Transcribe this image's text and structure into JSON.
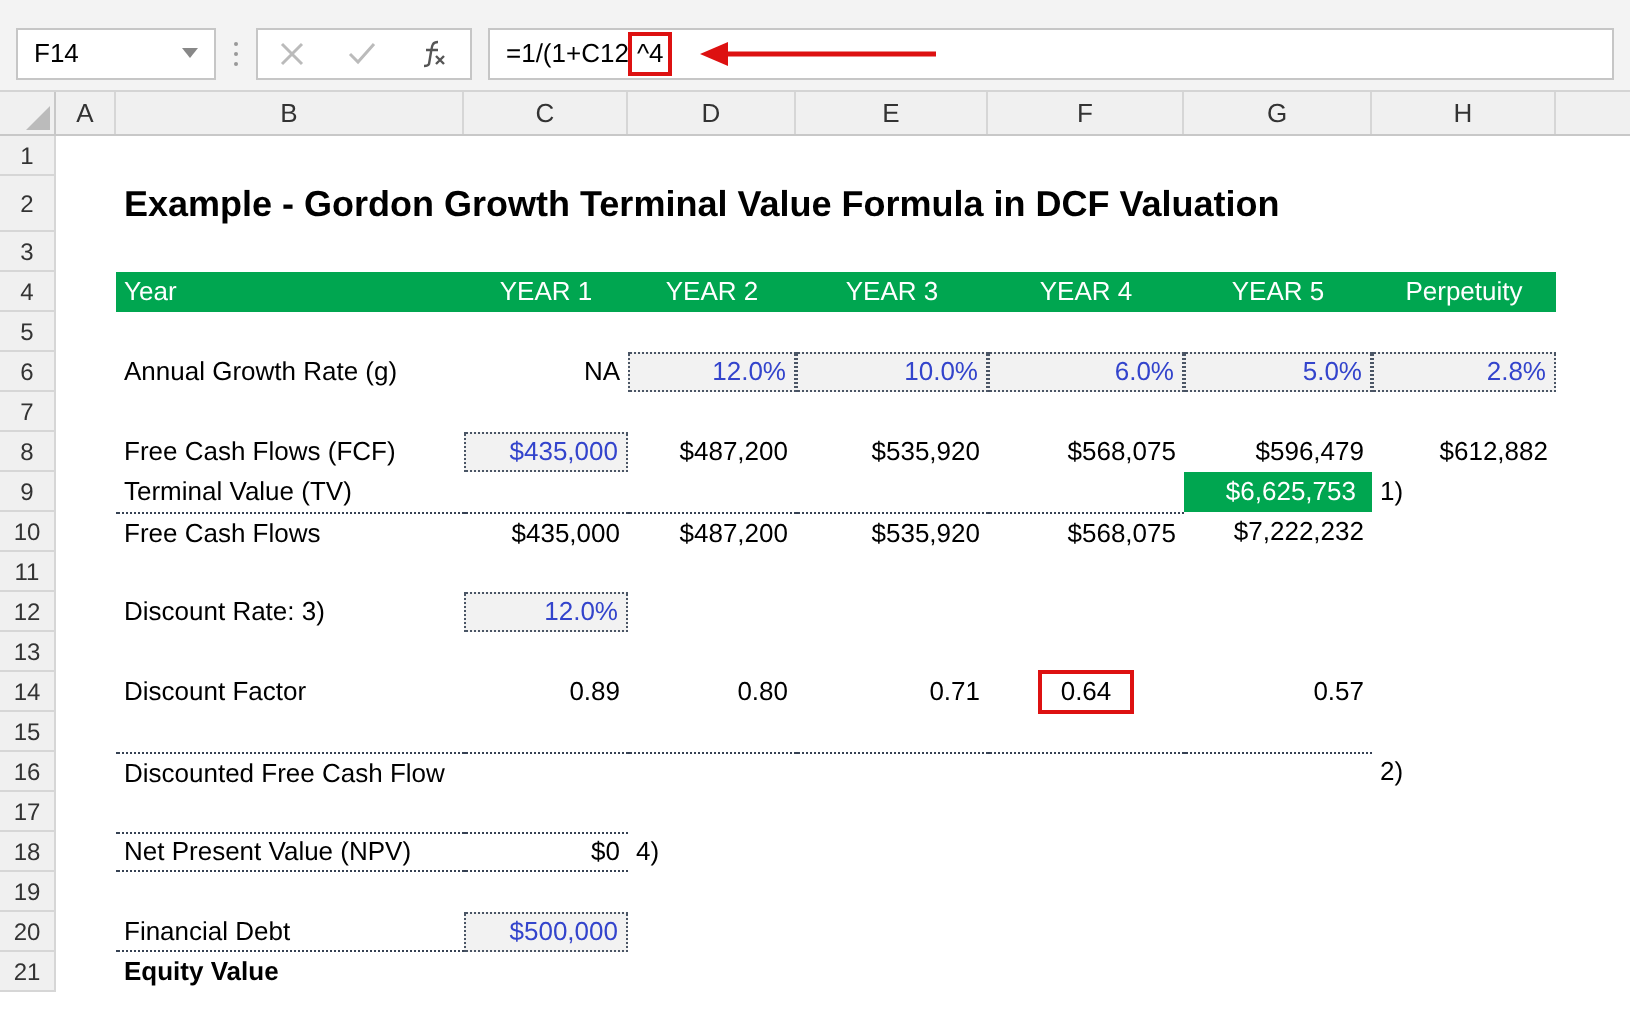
{
  "formula_bar": {
    "name_box": "F14",
    "formula": "=1/(1+C12",
    "formula_highlight": "^4"
  },
  "columns": [
    "A",
    "B",
    "C",
    "D",
    "E",
    "F",
    "G",
    "H"
  ],
  "rows": [
    {
      "number": "1",
      "cells": {}
    },
    {
      "number": "2",
      "cells": {
        "B": {
          "kind": "title",
          "text": "Example - Gordon Growth Terminal Value Formula in DCF Valuation"
        }
      }
    },
    {
      "number": "3",
      "cells": {}
    },
    {
      "number": "4",
      "cells": {
        "B": {
          "kind": "header_label",
          "text": "Year"
        },
        "C": {
          "kind": "header",
          "text": "YEAR 1"
        },
        "D": {
          "kind": "header",
          "text": "YEAR 2"
        },
        "E": {
          "kind": "header",
          "text": "YEAR 3"
        },
        "F": {
          "kind": "header",
          "text": "YEAR 4"
        },
        "G": {
          "kind": "header",
          "text": "YEAR 5"
        },
        "H": {
          "kind": "header",
          "text": "Perpetuity"
        }
      }
    },
    {
      "number": "5",
      "cells": {}
    },
    {
      "number": "6",
      "cells": {
        "B": {
          "kind": "label",
          "text": "Annual Growth Rate (g)"
        },
        "C": {
          "kind": "number",
          "text": "NA"
        },
        "D": {
          "kind": "input",
          "text": "12.0%"
        },
        "E": {
          "kind": "input",
          "text": "10.0%"
        },
        "F": {
          "kind": "input",
          "text": "6.0%"
        },
        "G": {
          "kind": "input",
          "text": "5.0%"
        },
        "H": {
          "kind": "input",
          "text": "2.8%"
        }
      }
    },
    {
      "number": "7",
      "cells": {}
    },
    {
      "number": "8",
      "cells": {
        "B": {
          "kind": "label",
          "text": "Free Cash Flows (FCF)"
        },
        "C": {
          "kind": "input",
          "text": "$435,000"
        },
        "D": {
          "kind": "number",
          "text": "$487,200"
        },
        "E": {
          "kind": "number",
          "text": "$535,920"
        },
        "F": {
          "kind": "number",
          "text": "$568,075"
        },
        "G": {
          "kind": "number",
          "text": "$596,479"
        },
        "H": {
          "kind": "number",
          "text": "$612,882"
        }
      }
    },
    {
      "number": "9",
      "cells": {
        "B": {
          "kind": "label",
          "text": "Terminal Value (TV)"
        },
        "G": {
          "kind": "highlight",
          "text": "$6,625,753"
        },
        "H": {
          "kind": "note",
          "text": "1)"
        }
      }
    },
    {
      "number": "10",
      "rule_top": {
        "B": true,
        "C": true,
        "D": true,
        "E": true,
        "F": true
      },
      "cells": {
        "B": {
          "kind": "label",
          "text": "Free Cash Flows"
        },
        "C": {
          "kind": "number",
          "text": "$435,000"
        },
        "D": {
          "kind": "number",
          "text": "$487,200"
        },
        "E": {
          "kind": "number",
          "text": "$535,920"
        },
        "F": {
          "kind": "number",
          "text": "$568,075"
        },
        "G": {
          "kind": "number",
          "text": "$7,222,232"
        }
      }
    },
    {
      "number": "11",
      "cells": {}
    },
    {
      "number": "12",
      "cells": {
        "B": {
          "kind": "label",
          "text": "Discount Rate: 3)"
        },
        "C": {
          "kind": "input",
          "text": "12.0%"
        }
      }
    },
    {
      "number": "13",
      "cells": {}
    },
    {
      "number": "14",
      "cells": {
        "B": {
          "kind": "label",
          "text": "Discount Factor"
        },
        "C": {
          "kind": "number",
          "text": "0.89"
        },
        "D": {
          "kind": "number",
          "text": "0.80"
        },
        "E": {
          "kind": "number",
          "text": "0.71"
        },
        "F": {
          "kind": "boxed",
          "text": "0.64"
        },
        "G": {
          "kind": "number",
          "text": "0.57"
        }
      }
    },
    {
      "number": "15",
      "cells": {}
    },
    {
      "number": "16",
      "rule_top": {
        "B": true,
        "C": true,
        "D": true,
        "E": true,
        "F": true,
        "G": true
      },
      "cells": {
        "B": {
          "kind": "label",
          "text": "Discounted Free Cash Flow"
        },
        "H": {
          "kind": "note",
          "text": "2)"
        }
      }
    },
    {
      "number": "17",
      "cells": {}
    },
    {
      "number": "18",
      "rule_top": {
        "B": true,
        "C": true
      },
      "rule_bottom": {
        "B": true,
        "C": true
      },
      "cells": {
        "B": {
          "kind": "label",
          "text": "Net Present Value (NPV)"
        },
        "C": {
          "kind": "number",
          "text": "$0"
        },
        "D": {
          "kind": "note",
          "text": "4)"
        }
      }
    },
    {
      "number": "19",
      "cells": {}
    },
    {
      "number": "20",
      "rule_bottom": {
        "B": true
      },
      "cells": {
        "B": {
          "kind": "label",
          "text": "Financial Debt"
        },
        "C": {
          "kind": "input",
          "text": "$500,000"
        }
      }
    },
    {
      "number": "21",
      "cells": {
        "B": {
          "kind": "bold",
          "text": "Equity Value"
        }
      }
    }
  ]
}
